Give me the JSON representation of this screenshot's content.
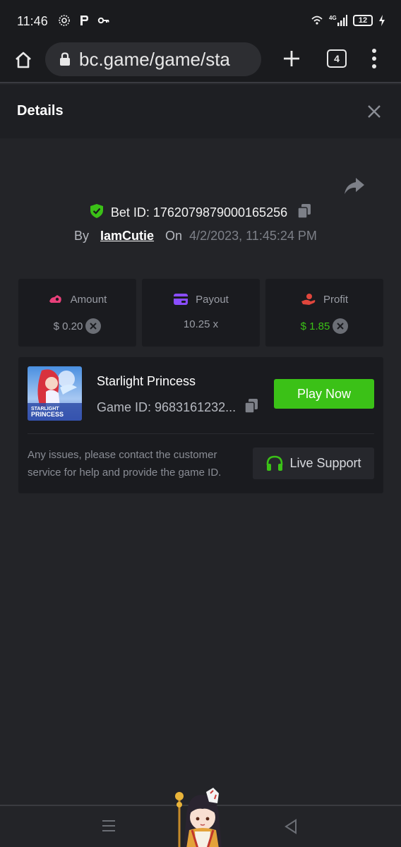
{
  "status_bar": {
    "time": "11:46",
    "network": "4G",
    "battery": "12",
    "icons": [
      "instagram-icon",
      "p-icon",
      "key-icon",
      "vpn-icon",
      "signal-icon",
      "battery-icon",
      "charging-icon"
    ]
  },
  "browser": {
    "url": "bc.game/game/sta",
    "tab_count": "4",
    "icons": [
      "home-icon",
      "lock-icon",
      "plus-icon",
      "more-vert-icon"
    ]
  },
  "details": {
    "title": "Details"
  },
  "bet": {
    "id_text": "Bet ID: 1762079879000165256",
    "by_label": "By",
    "username": "IamCutie",
    "on_label": "On",
    "date": "4/2/2023, 11:45:24 PM"
  },
  "stats": {
    "amount_label": "Amount",
    "amount_value": "$ 0.20",
    "payout_label": "Payout",
    "payout_value": "10.25 x",
    "profit_label": "Profit",
    "profit_value": "$ 1.85"
  },
  "game": {
    "name": "Starlight Princess",
    "id_text": "Game ID: 9683161232...",
    "thumb_text_1": "STARLIGHT",
    "thumb_text_2": "PRINCESS",
    "play_label": "Play Now",
    "issue_text": "Any issues, please contact the customer service for help and provide the game ID.",
    "support_label": "Live Support"
  },
  "colors": {
    "accent_green": "#3bc117",
    "background": "#232428",
    "card": "#1a1b1f",
    "amount_icon": "#e8407a",
    "payout_icon": "#8a4dff",
    "profit_icon": "#e0463c"
  }
}
